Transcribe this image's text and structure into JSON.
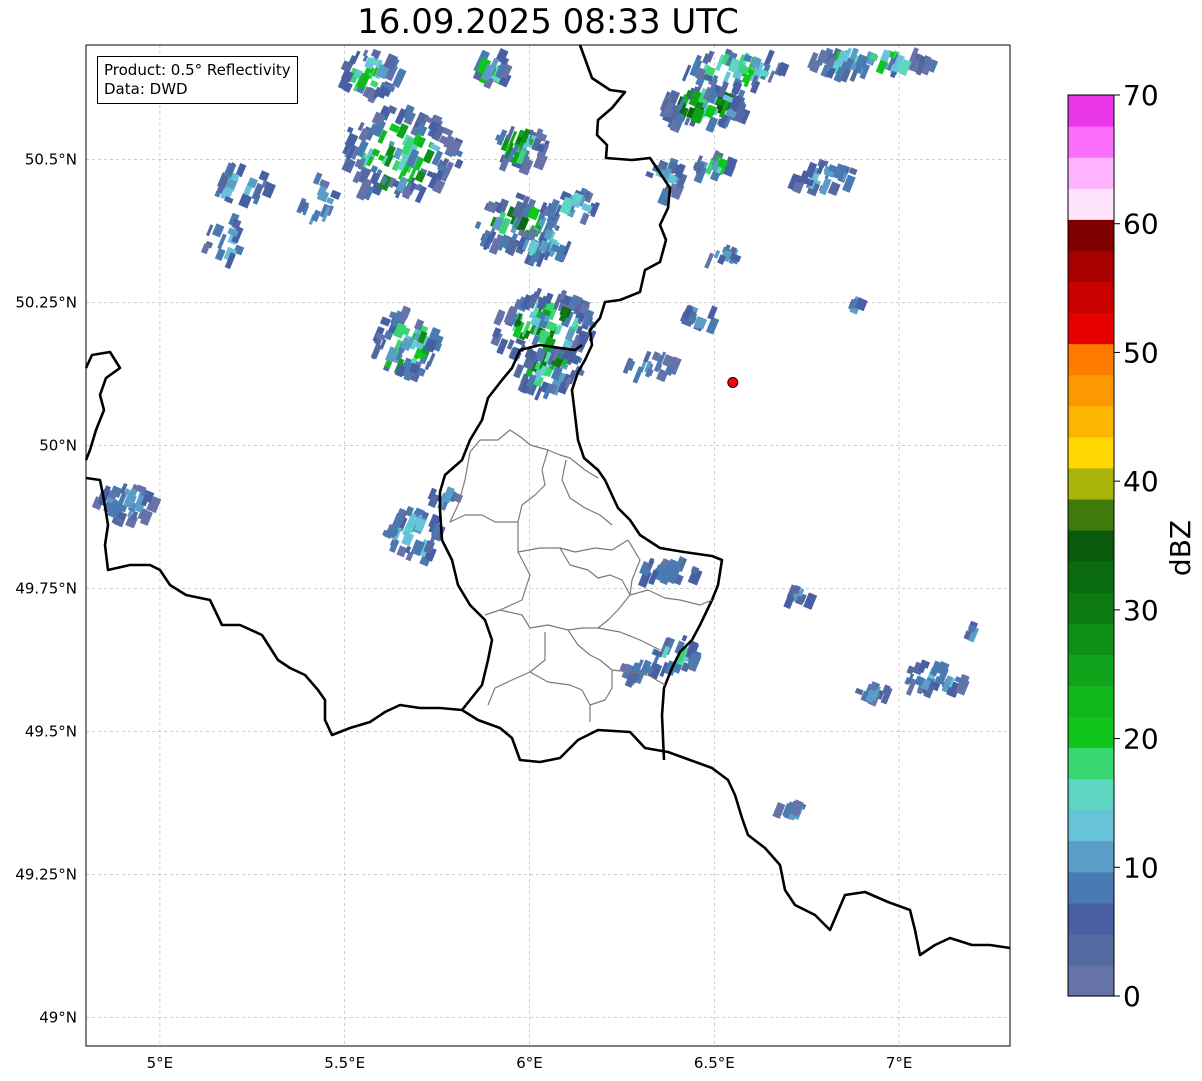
{
  "title": "16.09.2025 08:33 UTC",
  "info": {
    "product_line": "Product: 0.5° Reflectivity",
    "data_line": "Data: DWD"
  },
  "map": {
    "lon_range": [
      4.8,
      7.3
    ],
    "lat_range": [
      48.95,
      50.7
    ],
    "lon_ticks": [
      {
        "value": 5.0,
        "label": "5°E"
      },
      {
        "value": 5.5,
        "label": "5.5°E"
      },
      {
        "value": 6.0,
        "label": "6°E"
      },
      {
        "value": 6.5,
        "label": "6.5°E"
      },
      {
        "value": 7.0,
        "label": "7°E"
      }
    ],
    "lat_ticks": [
      {
        "value": 50.5,
        "label": "50.5°N"
      },
      {
        "value": 50.25,
        "label": "50.25°N"
      },
      {
        "value": 50.0,
        "label": "50°N"
      },
      {
        "value": 49.75,
        "label": "49.75°N"
      },
      {
        "value": 49.5,
        "label": "49.5°N"
      },
      {
        "value": 49.25,
        "label": "49.25°N"
      },
      {
        "value": 49.0,
        "label": "49°N"
      }
    ],
    "gridlines": true,
    "marker": {
      "lon": 6.55,
      "lat": 50.11,
      "color": "#ff0000"
    }
  },
  "colorbar": {
    "label": "dBZ",
    "min": 0,
    "max": 70,
    "step": 2.5,
    "tick_labels": [
      "0",
      "10",
      "20",
      "30",
      "40",
      "50",
      "60",
      "70"
    ],
    "colors": [
      "#6573a9",
      "#5569a1",
      "#4860a3",
      "#4a7ab2",
      "#5a9ec8",
      "#67c3d9",
      "#5ed6c2",
      "#3ad672",
      "#10c51c",
      "#10b81d",
      "#10a41c",
      "#0e8e15",
      "#0c7a11",
      "#0a6a0e",
      "#0b5a0c",
      "#3f7a0c",
      "#aab30a",
      "#fed700",
      "#fdb600",
      "#fc9800",
      "#fe7b00",
      "#e60000",
      "#c80000",
      "#a80000",
      "#800000",
      "#fee3fe",
      "#fdb3fd",
      "#fd6efd",
      "#e836e8"
    ]
  }
}
